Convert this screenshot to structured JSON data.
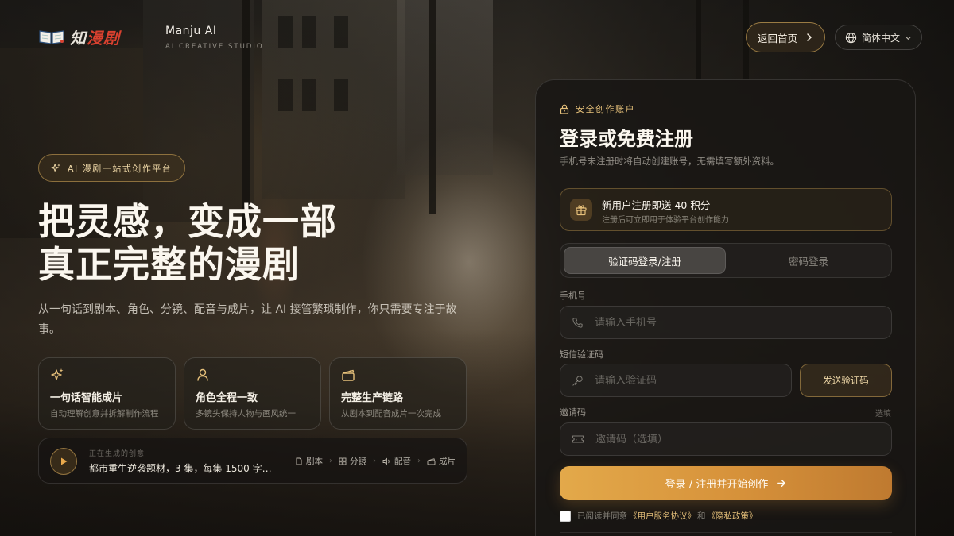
{
  "header": {
    "logo_text_a": "知",
    "logo_text_b": "漫剧",
    "brand_name": "Manju AI",
    "brand_sub": "AI CREATIVE STUDIO",
    "home_button": "返回首页",
    "language": "简体中文"
  },
  "hero": {
    "badge": "AI 漫剧一站式创作平台",
    "title_line1": "把灵感，变成一部",
    "title_line2": "真正完整的漫剧",
    "description": "从一句话到剧本、角色、分镜、配音与成片，让 AI 接管繁琐制作，你只需要专注于故事。",
    "features": [
      {
        "icon": "sparkles-icon",
        "title": "一句话智能成片",
        "desc": "自动理解创意并拆解制作流程"
      },
      {
        "icon": "user-icon",
        "title": "角色全程一致",
        "desc": "多镜头保持人物与画风统一"
      },
      {
        "icon": "clapperboard-icon",
        "title": "完整生产链路",
        "desc": "从剧本到配音成片一次完成"
      }
    ],
    "progress": {
      "label": "正在生成的创意",
      "text": "都市重生逆袭题材，3 集，每集 1500 字…",
      "steps": [
        "剧本",
        "分镜",
        "配音",
        "成片"
      ]
    }
  },
  "login": {
    "eyebrow": "安全创作账户",
    "title": "登录或免费注册",
    "subtitle": "手机号未注册时将自动创建账号，无需填写额外资料。",
    "gift_title": "新用户注册即送 40 积分",
    "gift_sub": "注册后可立即用于体验平台创作能力",
    "tab_active": "验证码登录/注册",
    "tab_inactive": "密码登录",
    "phone_label": "手机号",
    "phone_placeholder": "请输入手机号",
    "code_label": "短信验证码",
    "code_placeholder": "请输入验证码",
    "send_code": "发送验证码",
    "invite_label": "邀请码",
    "invite_optional": "选填",
    "invite_placeholder": "邀请码（选填）",
    "submit": "登录 / 注册并开始创作",
    "agree_prefix": "已阅读并同意",
    "agree_terms": "《用户服务协议》",
    "agree_and": "和",
    "agree_privacy": "《隐私政策》"
  },
  "colors": {
    "accent": "#e3a94a",
    "accent_text": "#e6c07a",
    "panel_bg": "#181614"
  }
}
